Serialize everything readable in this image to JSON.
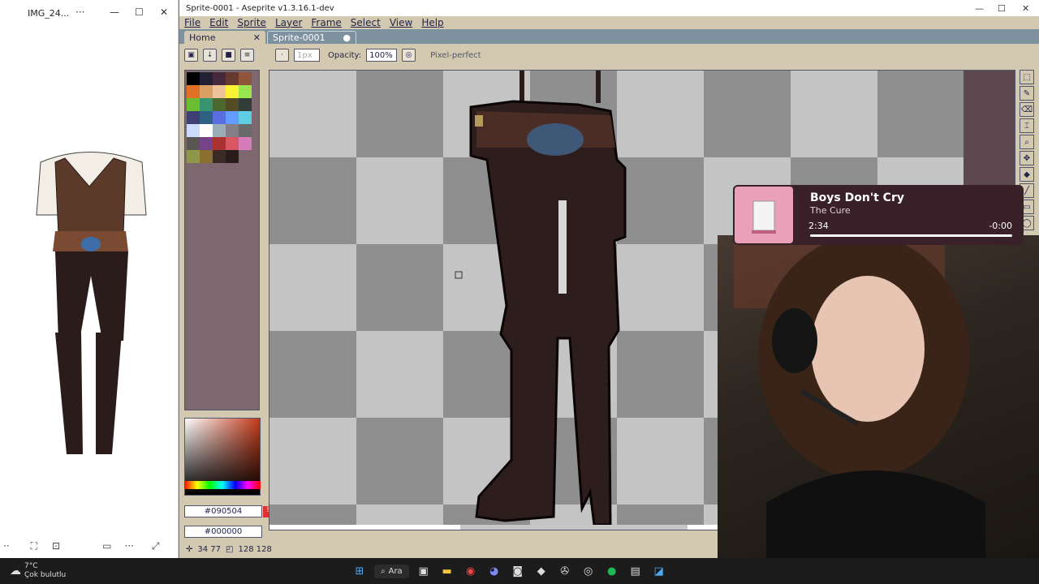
{
  "viewer": {
    "title": "IMG_24...",
    "more": "···",
    "min": "—",
    "max": "☐",
    "close": "✕"
  },
  "aseprite": {
    "window_title": "Sprite-0001 - Aseprite v1.3.16.1-dev",
    "menu": [
      "File",
      "Edit",
      "Sprite",
      "Layer",
      "Frame",
      "Select",
      "View",
      "Help"
    ],
    "tabs": {
      "home": "Home",
      "sprite": "Sprite-0001"
    },
    "context": {
      "brush_size": "1px",
      "opacity_label": "Opacity:",
      "opacity_value": "100%",
      "pixel_perfect": "Pixel-perfect"
    },
    "palette_colors": [
      "#000000",
      "#222034",
      "#45283c",
      "#663931",
      "#8f563b",
      "#df7126",
      "#d9a066",
      "#eec39a",
      "#fbf236",
      "#99e550",
      "#6abe30",
      "#37946e",
      "#4b692f",
      "#524b24",
      "#323c39",
      "#3f3f74",
      "#306082",
      "#5b6ee1",
      "#639bff",
      "#5fcde4",
      "#cbdbfc",
      "#ffffff",
      "#9badb7",
      "#847e87",
      "#696a6a",
      "#595652",
      "#76428a",
      "#ac3232",
      "#d95763",
      "#d77bba",
      "#8f974a",
      "#8a6f30",
      "#3b2a26",
      "#2a1c1a"
    ],
    "fg_hex": "#090504",
    "bg_hex": "#000000",
    "status": {
      "coords": "34 77",
      "size": "128 128"
    }
  },
  "now_playing": {
    "title": "Boys Don't Cry",
    "artist": "The Cure",
    "elapsed": "2:34",
    "remaining": "-0:00",
    "progress": 1.0
  },
  "taskbar": {
    "weather_temp": "7°C",
    "weather_desc": "Çok bulutlu",
    "search_label": "Ara"
  }
}
